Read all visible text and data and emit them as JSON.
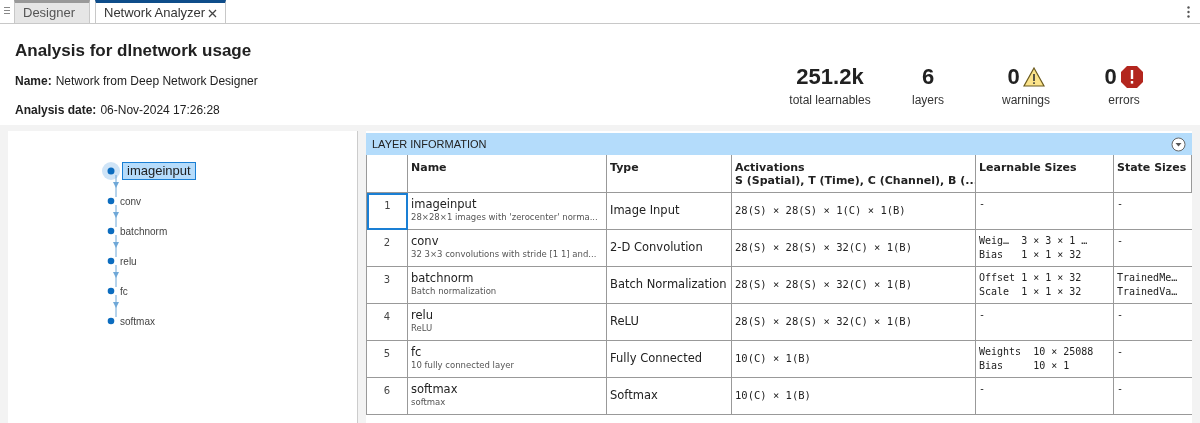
{
  "tabs": [
    {
      "label": "Designer",
      "selected": false,
      "closable": false
    },
    {
      "label": "Network Analyzer",
      "selected": true,
      "closable": true
    }
  ],
  "header": {
    "title": "Analysis for dlnetwork usage",
    "fields": [
      {
        "label": "Name:",
        "value": "Network from Deep Network Designer"
      },
      {
        "label": "Analysis date:",
        "value": "06-Nov-2024 17:26:28"
      }
    ]
  },
  "stats": [
    {
      "value": "251.2k",
      "label": "total learnables",
      "kind": "plain"
    },
    {
      "value": "6",
      "label": "layers",
      "kind": "plain"
    },
    {
      "value": "0",
      "label": "warnings",
      "kind": "warning"
    },
    {
      "value": "0",
      "label": "errors",
      "kind": "error"
    }
  ],
  "graph": {
    "nodes": [
      {
        "label": "imageinput",
        "selected": true
      },
      {
        "label": "conv",
        "selected": false
      },
      {
        "label": "batchnorm",
        "selected": false
      },
      {
        "label": "relu",
        "selected": false
      },
      {
        "label": "fc",
        "selected": false
      },
      {
        "label": "softmax",
        "selected": false
      }
    ]
  },
  "table": {
    "title": "LAYER INFORMATION",
    "columns": [
      {
        "title": "Name"
      },
      {
        "title": "Type"
      },
      {
        "title": "Activations",
        "subtitle": "S (Spatial), T (Time), C (Channel), B (..."
      },
      {
        "title": "Learnable Sizes"
      },
      {
        "title": "State Sizes"
      }
    ],
    "rows": [
      {
        "index": "1",
        "selected": true,
        "name": "imageinput",
        "description": "28×28×1 images with 'zerocenter' norma...",
        "type": "Image Input",
        "activations": "28(S) × 28(S) × 1(C) × 1(B)",
        "learnables": [
          "-"
        ],
        "states": [
          "-"
        ]
      },
      {
        "index": "2",
        "selected": false,
        "name": "conv",
        "description": "32 3×3 convolutions with stride [1 1] and...",
        "type": "2-D Convolution",
        "activations": "28(S) × 28(S) × 32(C) × 1(B)",
        "learnables": [
          "Weig…  3 × 3 × 1 …",
          "Bias   1 × 1 × 32"
        ],
        "states": [
          "-"
        ]
      },
      {
        "index": "3",
        "selected": false,
        "name": "batchnorm",
        "description": "Batch normalization",
        "type": "Batch Normalization",
        "activations": "28(S) × 28(S) × 32(C) × 1(B)",
        "learnables": [
          "Offset 1 × 1 × 32",
          "Scale  1 × 1 × 32"
        ],
        "states": [
          "TrainedMe…",
          "TrainedVa…"
        ]
      },
      {
        "index": "4",
        "selected": false,
        "name": "relu",
        "description": "ReLU",
        "type": "ReLU",
        "activations": "28(S) × 28(S) × 32(C) × 1(B)",
        "learnables": [
          "-"
        ],
        "states": [
          "-"
        ]
      },
      {
        "index": "5",
        "selected": false,
        "name": "fc",
        "description": "10 fully connected layer",
        "type": "Fully Connected",
        "activations": "10(C) × 1(B)",
        "learnables": [
          "Weights  10 × 25088",
          "Bias     10 × 1"
        ],
        "states": [
          "-"
        ]
      },
      {
        "index": "6",
        "selected": false,
        "name": "softmax",
        "description": "softmax",
        "type": "Softmax",
        "activations": "10(C) × 1(B)",
        "learnables": [
          "-"
        ],
        "states": [
          "-"
        ]
      }
    ]
  }
}
